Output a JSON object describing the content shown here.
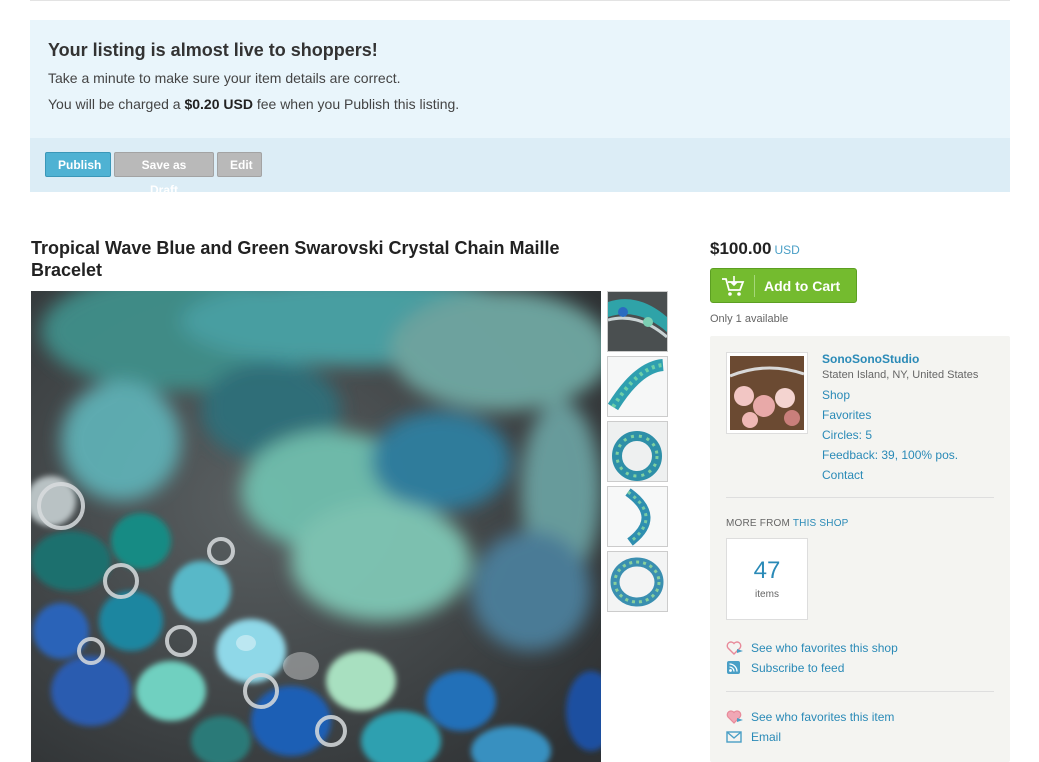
{
  "notice": {
    "title": "Your listing is almost live to shoppers!",
    "line1": "Take a minute to make sure your item details are correct.",
    "line2_prefix": "You will be charged a ",
    "line2_fee": "$0.20 USD",
    "line2_suffix": " fee when you Publish this listing.",
    "buttons": {
      "publish": "Publish",
      "draft": "Save as Draft",
      "edit": "Edit"
    }
  },
  "listing": {
    "title": "Tropical Wave Blue and Green Swarovski Crystal Chain Maille Bracelet",
    "price": "$100.00",
    "currency": "USD",
    "add_to_cart": "Add to Cart",
    "availability": "Only 1 available",
    "thumbnail_count": 5
  },
  "shop": {
    "name": "SonoSonoStudio",
    "location": "Staten Island, NY, United States",
    "links": [
      "Shop",
      "Favorites",
      "Circles: 5",
      "Feedback: 39, 100% pos.",
      "Contact"
    ],
    "more_from_prefix": "MORE FROM",
    "more_from_link": "THIS SHOP",
    "items_count": "47",
    "items_label": "items",
    "actions": {
      "fav_shop": "See who favorites this shop",
      "subscribe": "Subscribe to feed",
      "fav_item": "See who favorites this item",
      "email": "Email"
    }
  },
  "colors": {
    "notice_bg": "#e9f5fb",
    "publish_button": "#4fb2d3",
    "cart_button": "#74bb2f",
    "link": "#2a8ab7"
  },
  "icons": [
    "cart-icon",
    "heart-icon",
    "rss-icon",
    "envelope-icon"
  ]
}
